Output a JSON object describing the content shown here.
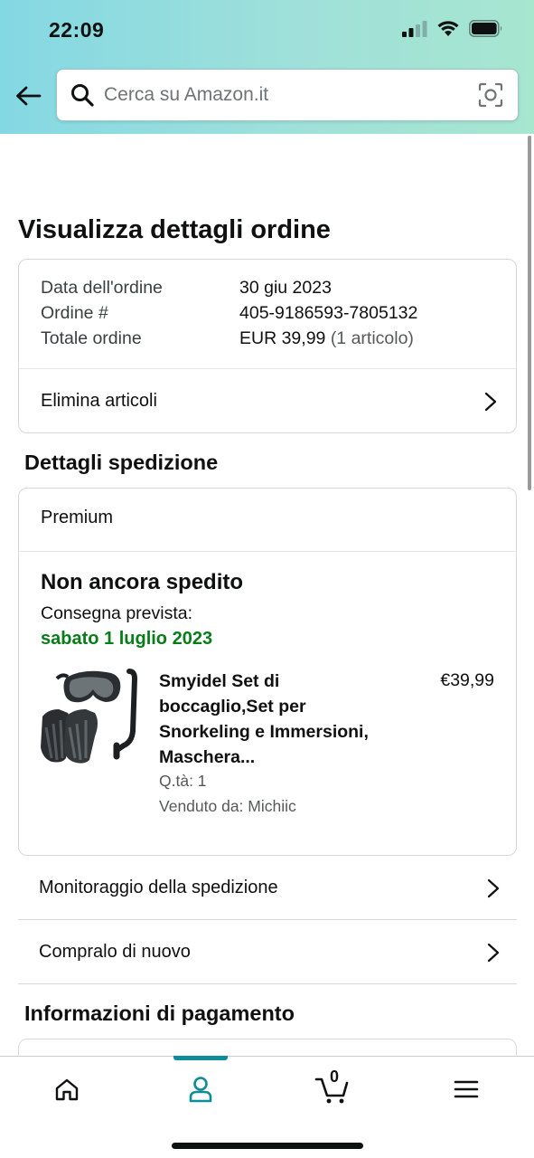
{
  "status_bar": {
    "time": "22:09"
  },
  "search": {
    "placeholder": "Cerca su Amazon.it"
  },
  "page": {
    "title": "Visualizza dettagli ordine"
  },
  "order_summary": {
    "rows": [
      {
        "label": "Data dell'ordine",
        "value": "30 giu 2023"
      },
      {
        "label": "Ordine #",
        "value": "405-9186593-7805132"
      },
      {
        "label": "Totale ordine",
        "value": "EUR 39,99",
        "extra": "(1 articolo)"
      }
    ],
    "delete_items_label": "Elimina articoli"
  },
  "shipping": {
    "section_title": "Dettagli spedizione",
    "service": "Premium",
    "status": "Non ancora spedito",
    "delivery_label": "Consegna prevista:",
    "delivery_date": "sabato 1 luglio 2023",
    "product": {
      "title": "Smyidel Set di boccaglio,Set per Snorkeling e Immersioni, Maschera...",
      "price": "€39,99",
      "quantity": "Q.tà: 1",
      "seller": "Venduto da: Michiic"
    }
  },
  "actions": [
    {
      "label": "Monitoraggio della spedizione"
    },
    {
      "label": "Compralo di nuovo"
    }
  ],
  "payment": {
    "section_title": "Informazioni di pagamento"
  },
  "bottom_nav": {
    "items": [
      "home-icon",
      "account-icon",
      "cart-icon",
      "menu-icon"
    ],
    "active": "account-icon",
    "cart_count": "0",
    "accent_color": "#0e8c9a"
  },
  "colors": {
    "delivery_green": "#067d17",
    "header_gradient_start": "#84d8e3",
    "header_gradient_end": "#a7e6cf"
  }
}
